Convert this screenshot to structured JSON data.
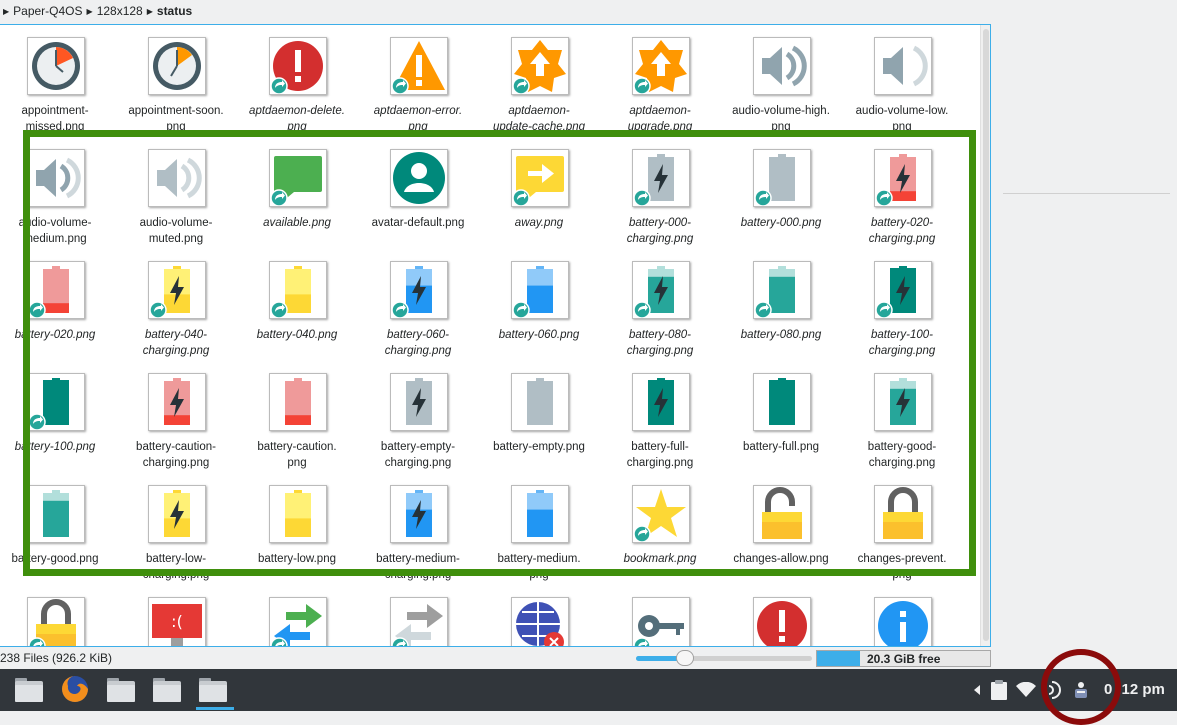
{
  "breadcrumb": [
    "Paper-Q4OS",
    "128x128",
    "status"
  ],
  "files": [
    {
      "name": "appointment-\nmissed.png",
      "icon": "clock-missed",
      "italic": false,
      "link": false
    },
    {
      "name": "appointment-soon.\npng",
      "icon": "clock-soon",
      "italic": false,
      "link": false
    },
    {
      "name": "aptdaemon-delete.\npng",
      "icon": "error-red-circle",
      "italic": true,
      "link": true
    },
    {
      "name": "aptdaemon-error.\npng",
      "icon": "warning-triangle",
      "italic": true,
      "link": true
    },
    {
      "name": "aptdaemon-\nupdate-cache.png",
      "icon": "upgrade-badge",
      "italic": true,
      "link": true
    },
    {
      "name": "aptdaemon-\nupgrade.png",
      "icon": "upgrade-badge",
      "italic": true,
      "link": true
    },
    {
      "name": "audio-volume-high.\npng",
      "icon": "speaker-high",
      "italic": false,
      "link": false
    },
    {
      "name": "audio-volume-low.\npng",
      "icon": "speaker-low",
      "italic": false,
      "link": false
    },
    {
      "name": "audio-volume-\nmedium.png",
      "icon": "speaker-medium",
      "italic": false,
      "link": false
    },
    {
      "name": "audio-volume-\nmuted.png",
      "icon": "speaker-muted",
      "italic": false,
      "link": false
    },
    {
      "name": "available.png",
      "icon": "chat-green",
      "italic": true,
      "link": true
    },
    {
      "name": "avatar-default.png",
      "icon": "avatar-teal",
      "italic": false,
      "link": false
    },
    {
      "name": "away.png",
      "icon": "chat-yellow-arrow",
      "italic": true,
      "link": true
    },
    {
      "name": "battery-000-\ncharging.png",
      "icon": "battery-grey-bolt",
      "italic": true,
      "link": true
    },
    {
      "name": "battery-000.png",
      "icon": "battery-grey",
      "italic": true,
      "link": true
    },
    {
      "name": "battery-020-\ncharging.png",
      "icon": "battery-red-bolt",
      "italic": true,
      "link": true
    },
    {
      "name": "battery-020.png",
      "icon": "battery-red",
      "italic": true,
      "link": true
    },
    {
      "name": "battery-040-\ncharging.png",
      "icon": "battery-yellow-bolt",
      "italic": true,
      "link": true
    },
    {
      "name": "battery-040.png",
      "icon": "battery-yellow",
      "italic": true,
      "link": true
    },
    {
      "name": "battery-060-\ncharging.png",
      "icon": "battery-blue-bolt",
      "italic": true,
      "link": true
    },
    {
      "name": "battery-060.png",
      "icon": "battery-blue",
      "italic": true,
      "link": true
    },
    {
      "name": "battery-080-\ncharging.png",
      "icon": "battery-teal-bolt",
      "italic": true,
      "link": true
    },
    {
      "name": "battery-080.png",
      "icon": "battery-teal",
      "italic": true,
      "link": true
    },
    {
      "name": "battery-100-\ncharging.png",
      "icon": "battery-full-bolt",
      "italic": true,
      "link": true
    },
    {
      "name": "battery-100.png",
      "icon": "battery-full",
      "italic": true,
      "link": true
    },
    {
      "name": "battery-caution-\ncharging.png",
      "icon": "battery-red-bolt",
      "italic": false,
      "link": false
    },
    {
      "name": "battery-caution.\npng",
      "icon": "battery-red",
      "italic": false,
      "link": false
    },
    {
      "name": "battery-empty-\ncharging.png",
      "icon": "battery-grey-bolt",
      "italic": false,
      "link": false
    },
    {
      "name": "battery-empty.png",
      "icon": "battery-grey",
      "italic": false,
      "link": false
    },
    {
      "name": "battery-full-\ncharging.png",
      "icon": "battery-full-bolt",
      "italic": false,
      "link": false
    },
    {
      "name": "battery-full.png",
      "icon": "battery-full",
      "italic": false,
      "link": false
    },
    {
      "name": "battery-good-\ncharging.png",
      "icon": "battery-teal-bolt",
      "italic": false,
      "link": false
    },
    {
      "name": "battery-good.png",
      "icon": "battery-teal",
      "italic": false,
      "link": false
    },
    {
      "name": "battery-low-\ncharging.png",
      "icon": "battery-yellow-bolt",
      "italic": false,
      "link": false
    },
    {
      "name": "battery-low.png",
      "icon": "battery-yellow",
      "italic": false,
      "link": false
    },
    {
      "name": "battery-medium-\ncharging.png",
      "icon": "battery-blue-bolt",
      "italic": false,
      "link": false
    },
    {
      "name": "battery-medium.\npng",
      "icon": "battery-blue",
      "italic": false,
      "link": false
    },
    {
      "name": "bookmark.png",
      "icon": "star-yellow",
      "italic": true,
      "link": true
    },
    {
      "name": "changes-allow.png",
      "icon": "lock-open",
      "italic": false,
      "link": false
    },
    {
      "name": "changes-prevent.\npng",
      "icon": "lock-closed",
      "italic": false,
      "link": false
    },
    {
      "name": "",
      "icon": "lock-closed",
      "italic": false,
      "link": true
    },
    {
      "name": "",
      "icon": "computer-fail",
      "italic": false,
      "link": false
    },
    {
      "name": "",
      "icon": "arrows-green-blue",
      "italic": false,
      "link": true
    },
    {
      "name": "",
      "icon": "arrows-grey",
      "italic": false,
      "link": true
    },
    {
      "name": "",
      "icon": "globe-error",
      "italic": false,
      "link": false
    },
    {
      "name": "",
      "icon": "key-teal",
      "italic": false,
      "link": true
    },
    {
      "name": "",
      "icon": "error-red-circle",
      "italic": false,
      "link": false
    },
    {
      "name": "",
      "icon": "info-blue-circle",
      "italic": false,
      "link": false
    }
  ],
  "status": {
    "count": "238 Files (926.2 KiB)",
    "zoom_fraction": 0.28,
    "free_space": "20.3 GiB free",
    "free_fraction": 0.25
  },
  "clock": "0 :12 pm",
  "colors": {
    "accent": "#3daee9",
    "highlight_green": "#3f8f0c",
    "highlight_red": "#8b0b0b",
    "taskbar": "#31363b"
  }
}
